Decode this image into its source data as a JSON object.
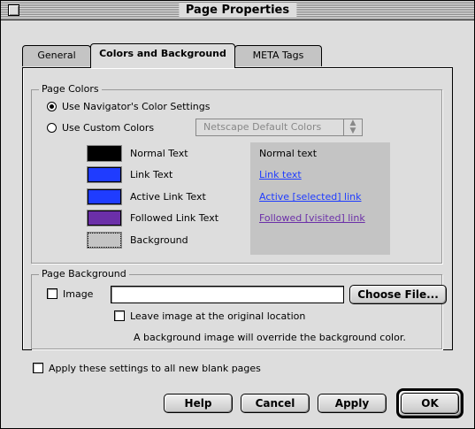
{
  "window": {
    "title": "Page Properties"
  },
  "tabs": [
    {
      "label": "General"
    },
    {
      "label": "Colors and Background"
    },
    {
      "label": "META Tags"
    }
  ],
  "page_colors": {
    "group_label": "Page Colors",
    "use_navigator_label": "Use Navigator's Color Settings",
    "use_custom_label": "Use Custom Colors",
    "preset_popup_value": "Netscape Default Colors",
    "selected_option": "use_navigator",
    "items": [
      {
        "label": "Normal Text",
        "color": "#000000",
        "preview": "Normal text"
      },
      {
        "label": "Link Text",
        "color": "#1f3cff",
        "preview": "Link text"
      },
      {
        "label": "Active Link Text",
        "color": "#1f3cff",
        "preview": "Active [selected] link"
      },
      {
        "label": "Followed Link Text",
        "color": "#6b2fa8",
        "preview": "Followed [visited] link"
      },
      {
        "label": "Background",
        "color": "#c4c4c4"
      }
    ]
  },
  "page_background": {
    "group_label": "Page Background",
    "image_label": "Image",
    "image_path_value": "",
    "choose_file_label": "Choose File...",
    "leave_image_label": "Leave image at the original location",
    "note": "A background image will override the background color."
  },
  "apply_all_label": "Apply these settings to all new blank pages",
  "buttons": {
    "help": "Help",
    "cancel": "Cancel",
    "apply": "Apply",
    "ok": "OK"
  }
}
